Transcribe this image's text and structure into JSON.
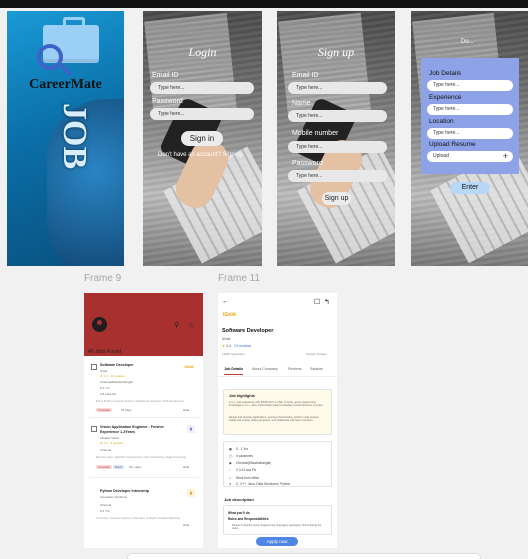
{
  "splash": {
    "title": "CareerMate",
    "job_text": "JOB"
  },
  "login": {
    "title": "Login",
    "email_label": "Email ID",
    "email_placeholder": "Type here...",
    "password_label": "Password",
    "password_placeholder": "Type here...",
    "signin_button": "Sign in",
    "footer": "Don't have an account? Sign up"
  },
  "signup": {
    "title": "Sign up",
    "fields": [
      {
        "label": "Email ID",
        "placeholder": "Type here..."
      },
      {
        "label": "Name",
        "placeholder": "Type here..."
      },
      {
        "label": "Mobile number",
        "placeholder": "Type here..."
      },
      {
        "label": "Password",
        "placeholder": "Type here..."
      }
    ],
    "signup_button": "Sign up"
  },
  "job_form": {
    "top_text": "Do...",
    "fields": [
      {
        "label": "Job Details",
        "placeholder": "Type here..."
      },
      {
        "label": "Experience",
        "placeholder": "Type here..."
      },
      {
        "label": "Location",
        "placeholder": "Type here..."
      }
    ],
    "upload_label": "Upload Resume",
    "upload_value": "Upload",
    "upload_icon": "+",
    "enter_button": "Enter"
  },
  "frame9": {
    "label": "Frame 9",
    "jobs_found": "40 Jobs Found",
    "header_icons": [
      "search-icon",
      "bell-icon"
    ],
    "jobs": [
      {
        "title": "Software Developer",
        "company": "iGold",
        "rating": "★ 3.4 · 13 reviews",
        "location": "Chennai(Ekkattuthangal)",
        "experience": "0-1 Yrs",
        "salary": "3-6 Lacs PA",
        "desc": "B.E or B.Tech Computer Science, Software Development, Web Development",
        "tag1": "6 reviews",
        "tag2": "",
        "posted": "15 days",
        "action": "Hide",
        "logo": "iGold"
      },
      {
        "title": "Vision Application Engineer - Fresher Experience 1-3Years",
        "company": "Intellect Vision",
        "rating": "★ 2.6 · 4 reviews",
        "location": "Chennai",
        "experience": "",
        "salary": "",
        "desc": "Machine Vision, Algorithm Development, Vision Processing, Image Processing",
        "tag1": "4 reviews",
        "tag2": "Top 1",
        "posted": "30+ days",
        "action": "Hide",
        "logo": ""
      },
      {
        "title": "Python Developer Internship",
        "company": "Innovation Solutions",
        "rating": "",
        "location": "Chennai",
        "experience": "0-1 Yrs",
        "salary": "",
        "desc": "IT services, Computer science, Information, Analytics, Desktop Marketing, ...",
        "tag1": "",
        "tag2": "",
        "posted": "",
        "action": "Hide",
        "logo": ""
      }
    ]
  },
  "frame11": {
    "label": "Frame 11",
    "logo": "iGold",
    "title": "Software Developer",
    "company": "iGold",
    "rating": "3.4",
    "reviews": "13 reviews",
    "applicants": "19587 applicants",
    "posted": "Posted 16 days",
    "tabs": [
      "Job Details",
      "About Company",
      "Reviews",
      "Salaries"
    ],
    "highlights_title": "Job highlights",
    "highlights_1": "0 to 1 year experience with B.E/B.Tech in CSE, IT, ECE, good programming knowledge in C++, Java, Python/SQL basic knowledge in Data Structure is a plus",
    "highlights_2": "Design and develop applications, process photos/video, perform code reviews, quality test coding, debug programs, and collaborate with team members",
    "details": [
      {
        "icon": "briefcase-icon",
        "text": "0 - 1 Yrs"
      },
      {
        "icon": "clock-icon",
        "text": "4 vacancies"
      },
      {
        "icon": "location-icon",
        "text": "Chennai(Ekkattuthangal)"
      },
      {
        "icon": "money-icon",
        "text": "₹ 3-6 Lacs PA"
      },
      {
        "icon": "home-icon",
        "text": "Work from office"
      },
      {
        "icon": "skills-icon",
        "text": "C, C++, Java, Data Structures, Python"
      }
    ],
    "desc_title": "Job description",
    "what_title": "What you'll do",
    "role_title": "Roles and Responsibilities",
    "role_text": "Design & develop using programming languages separately. Test & debug the code...",
    "apply_button": "Apply now"
  }
}
